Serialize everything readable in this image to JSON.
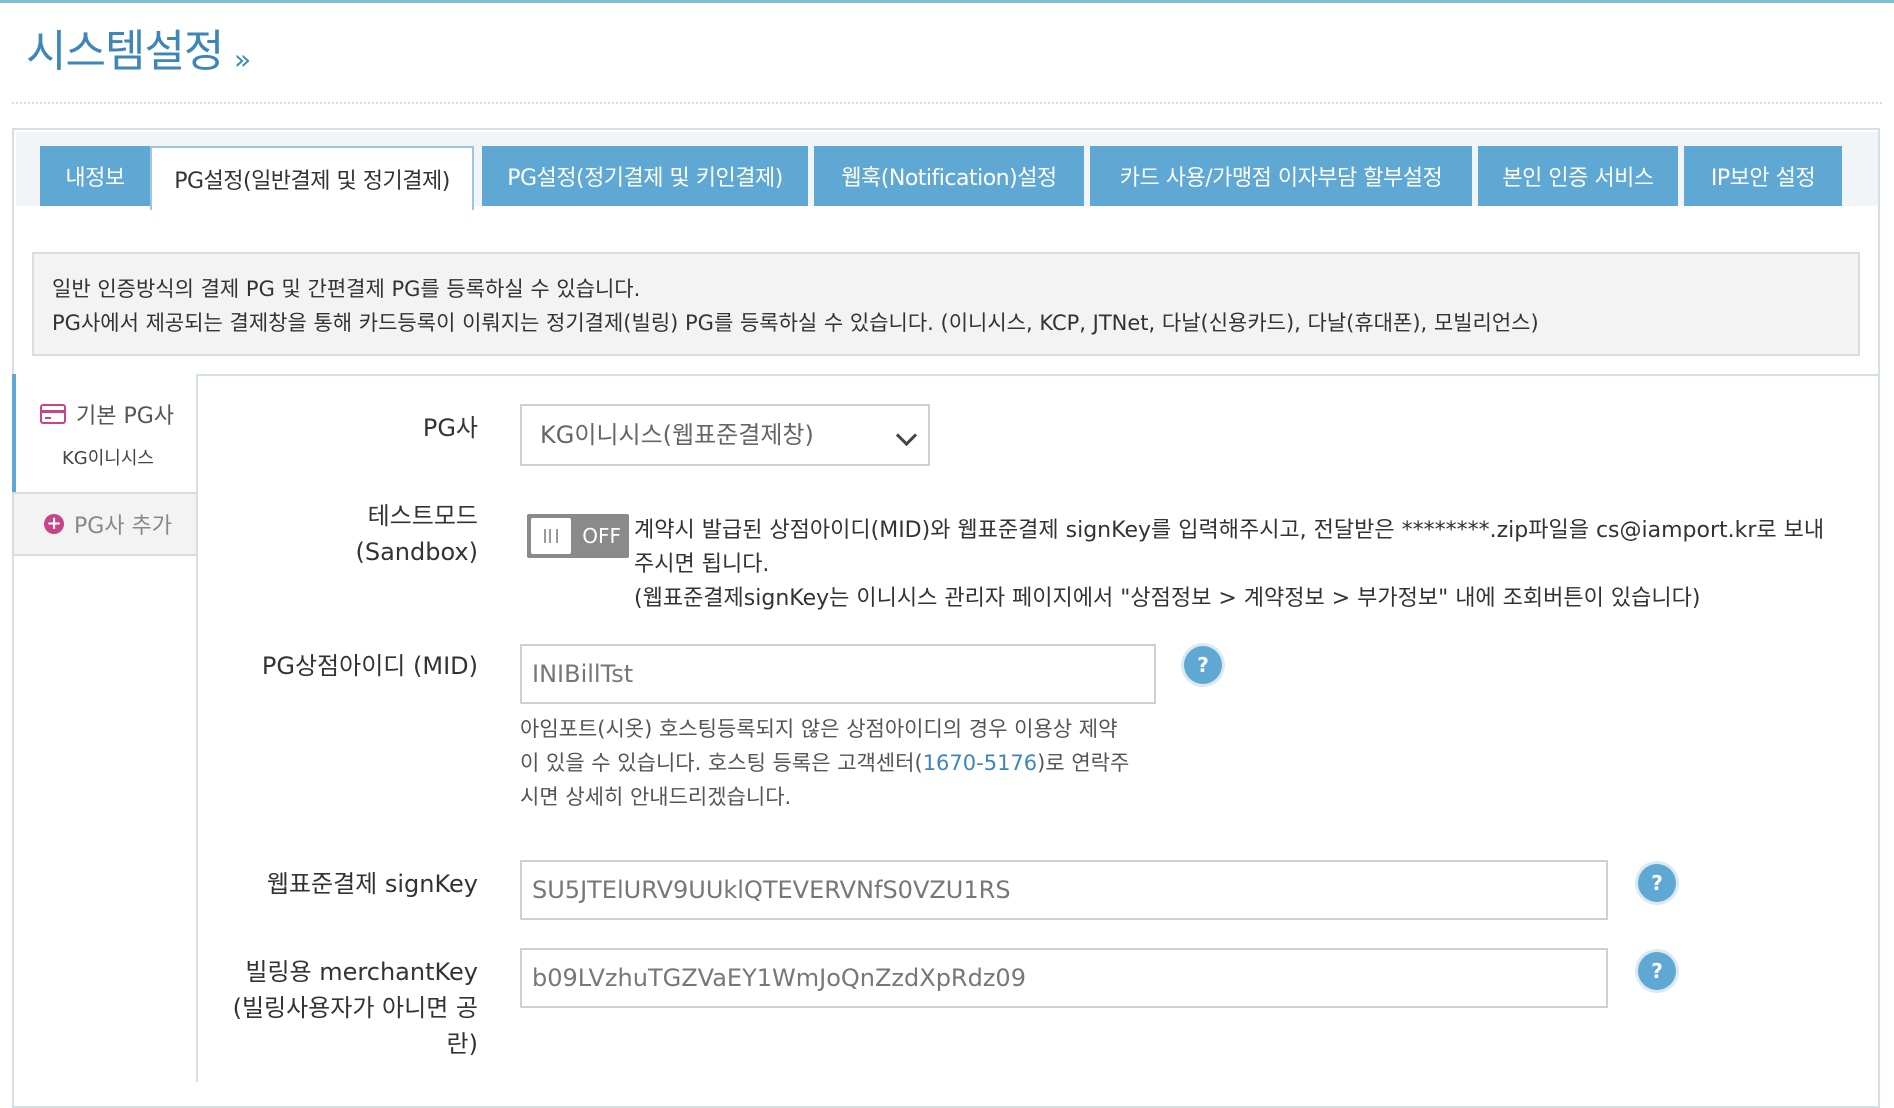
{
  "page": {
    "title": "시스템설정",
    "title_chevron": "»"
  },
  "tabs": [
    {
      "label": "내정보",
      "active": false
    },
    {
      "label": "PG설정(일반결제 및 정기결제)",
      "active": true
    },
    {
      "label": "PG설정(정기결제 및 키인결제)",
      "active": false
    },
    {
      "label": "웹훅(Notification)설정",
      "active": false
    },
    {
      "label": "카드 사용/가맹점 이자부담 할부설정",
      "active": false
    },
    {
      "label": "본인 인증 서비스",
      "active": false
    },
    {
      "label": "IP보안 설정",
      "active": false
    }
  ],
  "notice": {
    "line1": "일반 인증방식의 결제 PG 및 간편결제 PG를 등록하실 수 있습니다.",
    "line2": "PG사에서 제공되는 결제창을 통해 카드등록이 이뤄지는 정기결제(빌링) PG를 등록하실 수 있습니다. (이니시스, KCP, JTNet, 다날(신용카드), 다날(휴대폰), 모빌리언스)"
  },
  "sidebar": {
    "basic_pg_label": "기본 PG사",
    "basic_pg_value": "KG이니시스",
    "add_pg_label": "PG사 추가",
    "card_icon": "credit-card-icon",
    "plus_icon": "plus-circle-icon"
  },
  "form": {
    "pg_label": "PG사",
    "pg_selected": "KG이니시스(웹표준결제창)",
    "test_mode_label_1": "테스트모드",
    "test_mode_label_2": "(Sandbox)",
    "test_mode_state": "OFF",
    "test_mode_help_1": "계약시 발급된 상점아이디(MID)와 웹표준결제 signKey를 입력해주시고, 전달받은 ********.zip파일을 cs@iamport.kr로 보내",
    "test_mode_help_2": "주시면 됩니다.",
    "test_mode_help_3": "(웹표준결제signKey는 이니시스 관리자 페이지에서 \"상점정보 > 계약정보 > 부가정보\" 내에 조회버튼이 있습니다)",
    "mid_label": "PG상점아이디 (MID)",
    "mid_value": "INIBillTst",
    "mid_help_1": "아임포트(시옷) 호스팅등록되지 않은 상점아이디의 경우 이용상 제약",
    "mid_help_2a": "이 있을 수 있습니다. 호스팅 등록은 고객센터(",
    "mid_help_phone": "1670-5176",
    "mid_help_2b": ")로 연락주",
    "mid_help_3": "시면 상세히 안내드리겠습니다.",
    "signkey_label": "웹표준결제 signKey",
    "signkey_value": "SU5JTElURV9UUklQTEVERVNfS0VZU1RS",
    "merchantkey_label_1": "빌링용 merchantKey",
    "merchantkey_label_2": "(빌링사용자가 아니면 공",
    "merchantkey_label_3": "란)",
    "merchantkey_value": "b09LVzhuTGZVaEY1WmJoQnZzdXpRdz09",
    "help_button": "?"
  },
  "colors": {
    "accent": "#5ea8d3",
    "title": "#3d86b8",
    "pink_icon": "#c7448a",
    "toggle_off": "#8a8a8a"
  }
}
